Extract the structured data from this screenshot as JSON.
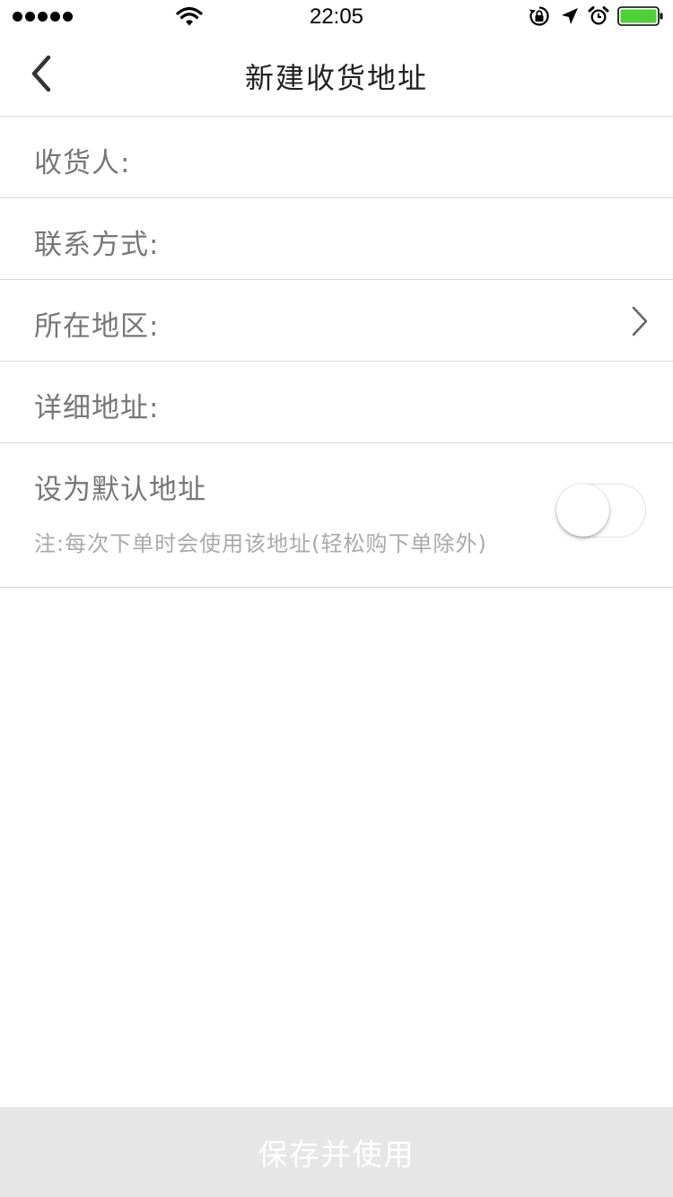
{
  "status_bar": {
    "time": "22:05",
    "signal_dots": 5,
    "battery_color": "#4cd137",
    "icons": [
      "wifi-icon",
      "rotation-lock-icon",
      "location-arrow-icon",
      "alarm-icon",
      "battery-icon"
    ]
  },
  "nav": {
    "back_icon": "chevron-left-icon",
    "title": "新建收货地址"
  },
  "form": {
    "recipient_label": "收货人:",
    "recipient_value": "",
    "contact_label": "联系方式:",
    "contact_value": "",
    "region_label": "所在地区:",
    "region_icon": "chevron-right-icon",
    "address_label": "详细地址:",
    "address_value": ""
  },
  "default_address": {
    "title": "设为默认地址",
    "note": "注:每次下单时会使用该地址(轻松购下单除外)",
    "enabled": false
  },
  "footer": {
    "save_label": "保存并使用",
    "button_bg": "#e6e6e6"
  }
}
